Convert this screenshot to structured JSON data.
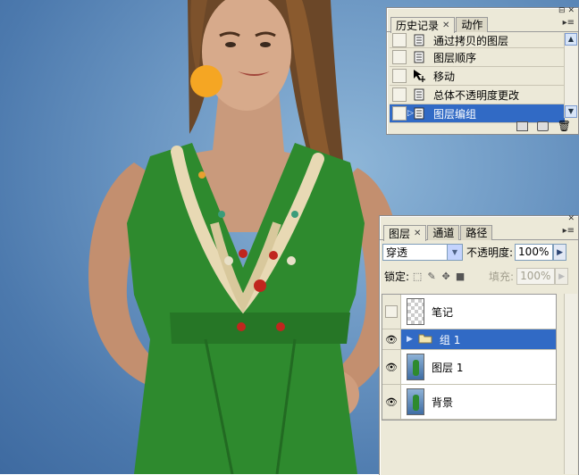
{
  "history_panel": {
    "tabs": [
      {
        "label": "历史记录",
        "active": true
      },
      {
        "label": "动作",
        "active": false
      }
    ],
    "items": [
      {
        "label": "通过拷贝的图层",
        "icon": "history-state-icon",
        "selected": false
      },
      {
        "label": "图层顺序",
        "icon": "history-state-icon",
        "selected": false
      },
      {
        "label": "移动",
        "icon": "move-tool-icon",
        "selected": false
      },
      {
        "label": "总体不透明度更改",
        "icon": "history-state-icon",
        "selected": false
      },
      {
        "label": "图层编组",
        "icon": "history-state-icon",
        "selected": true
      }
    ],
    "footer_icons": [
      "new-document-from-state-icon",
      "new-snapshot-icon",
      "delete-state-icon"
    ]
  },
  "layers_panel": {
    "tabs": [
      {
        "label": "图层",
        "active": true
      },
      {
        "label": "通道",
        "active": false
      },
      {
        "label": "路径",
        "active": false
      }
    ],
    "blend_mode": "穿透",
    "opacity_label": "不透明度:",
    "opacity_value": "100%",
    "lock_label": "锁定:",
    "lock_icons": [
      "lock-transparency-icon",
      "lock-image-icon",
      "lock-position-icon",
      "lock-all-icon"
    ],
    "fill_label": "填充:",
    "fill_value": "100%",
    "layers": [
      {
        "name": "笔记",
        "visible": false,
        "type": "transparent",
        "selected": false
      },
      {
        "name": "组 1",
        "visible": true,
        "type": "group",
        "selected": true
      },
      {
        "name": "图层 1",
        "visible": true,
        "type": "photo",
        "selected": false
      },
      {
        "name": "背景",
        "visible": true,
        "type": "photo",
        "selected": false
      }
    ]
  },
  "colors": {
    "selection": "#316ac5",
    "panel_bg": "#ece9d8",
    "dress_green": "#2e8a2e",
    "earring_orange": "#f5a623",
    "backdrop_blue": "#5f8bbd"
  }
}
